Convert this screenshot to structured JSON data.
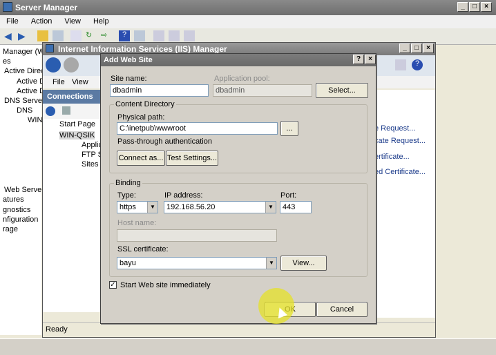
{
  "server_manager": {
    "title": "Server Manager",
    "menu": [
      "File",
      "Action",
      "View",
      "Help"
    ],
    "tree": [
      "Manager (W",
      "es",
      "Active Direc",
      "Active D",
      "Active D",
      "DNS Server",
      "DNS",
      "WIN",
      "Web Server",
      "atures",
      "gnostics",
      "nfiguration",
      "rage"
    ]
  },
  "iis": {
    "title": "Internet Information Services (IIS) Manager",
    "menu": [
      "File",
      "View"
    ],
    "connections_header": "Connections",
    "tree": [
      "Start Page",
      "WIN-QSIK",
      "Applic",
      "FTP Si",
      "Sites"
    ],
    "actions": [
      "e Request...",
      "cate Request...",
      "ertificate...",
      "ed Certificate..."
    ],
    "status": "Ready"
  },
  "dialog": {
    "title": "Add Web Site",
    "site_name_label": "Site name:",
    "site_name_value": "dbadmin",
    "app_pool_label": "Application pool:",
    "app_pool_value": "dbadmin",
    "select_button": "Select...",
    "content_group": "Content Directory",
    "physical_path_label": "Physical path:",
    "physical_path_value": "C:\\inetpub\\wwwroot",
    "browse_button": "...",
    "passthrough_label": "Pass-through authentication",
    "connect_as_button": "Connect as...",
    "test_settings_button": "Test Settings...",
    "binding_group": "Binding",
    "type_label": "Type:",
    "type_value": "https",
    "ip_label": "IP address:",
    "ip_value": "192.168.56.20",
    "port_label": "Port:",
    "port_value": "443",
    "host_label": "Host name:",
    "host_value": "",
    "ssl_label": "SSL certificate:",
    "ssl_value": "bayu",
    "view_button": "View...",
    "start_label": "Start Web site immediately",
    "start_checked": true,
    "ok_button": "OK",
    "cancel_button": "Cancel"
  }
}
